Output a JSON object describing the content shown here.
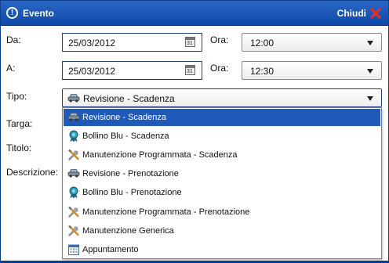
{
  "dialog": {
    "title": "Evento",
    "close_label": "Chiudi"
  },
  "form": {
    "da_label": "Da:",
    "da_date": "25/03/2012",
    "ora1_label": "Ora:",
    "ora1_value": "12:00",
    "a_label": "A:",
    "a_date": "25/03/2012",
    "ora2_label": "Ora:",
    "ora2_value": "12:30",
    "tipo_label": "Tipo:",
    "tipo_value": "Revisione - Scadenza",
    "targa_label": "Targa:",
    "titolo_label": "Titolo:",
    "descrizione_label": "Descrizione:"
  },
  "dropdown": {
    "items": [
      {
        "label": "Revisione - Scadenza",
        "icon": "car-icon",
        "selected": true
      },
      {
        "label": "Bollino Blu - Scadenza",
        "icon": "badge-icon",
        "selected": false
      },
      {
        "label": "Manutenzione Programmata - Scadenza",
        "icon": "tools-icon",
        "selected": false
      },
      {
        "label": "Revisione - Prenotazione",
        "icon": "car-icon",
        "selected": false
      },
      {
        "label": "Bollino Blu - Prenotazione",
        "icon": "badge-icon",
        "selected": false
      },
      {
        "label": "Manutenzione Programmata - Prenotazione",
        "icon": "tools-icon",
        "selected": false
      },
      {
        "label": "Manutenzione Generica",
        "icon": "tools-icon",
        "selected": false
      },
      {
        "label": "Appuntamento",
        "icon": "calendar-icon",
        "selected": false
      }
    ]
  },
  "colors": {
    "titlebar": "#1a57b8",
    "selection": "#1f5ab8",
    "close_x": "#e0312a"
  }
}
